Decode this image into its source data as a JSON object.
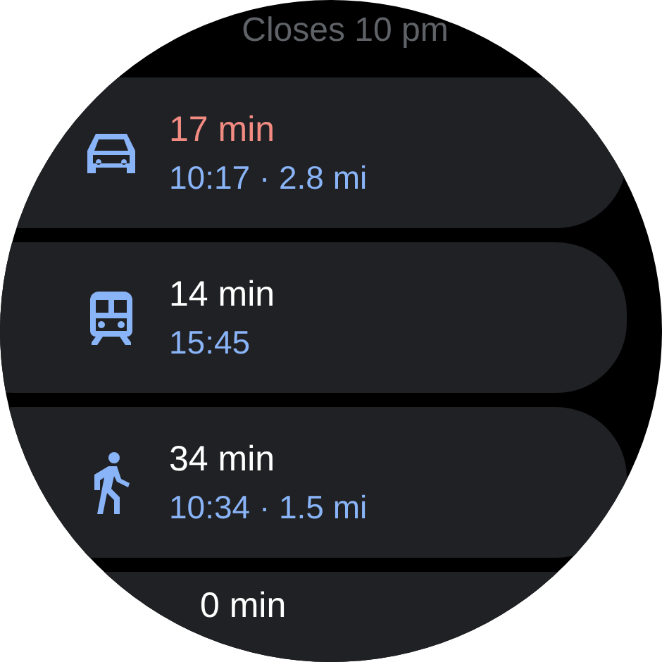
{
  "header": {
    "hours": "Closes 10 pm"
  },
  "routes": [
    {
      "kind": "car",
      "duration": "17 min",
      "color": "#f28b82",
      "details": "10:17 · 2.8 mi"
    },
    {
      "kind": "train",
      "duration": "14 min",
      "color": "#ffffff",
      "details": "15:45"
    },
    {
      "kind": "walk",
      "duration": "34 min",
      "color": "#ffffff",
      "details": "10:34 · 1.5 mi"
    },
    {
      "duration": "0 min",
      "color": "#ffffff"
    }
  ]
}
